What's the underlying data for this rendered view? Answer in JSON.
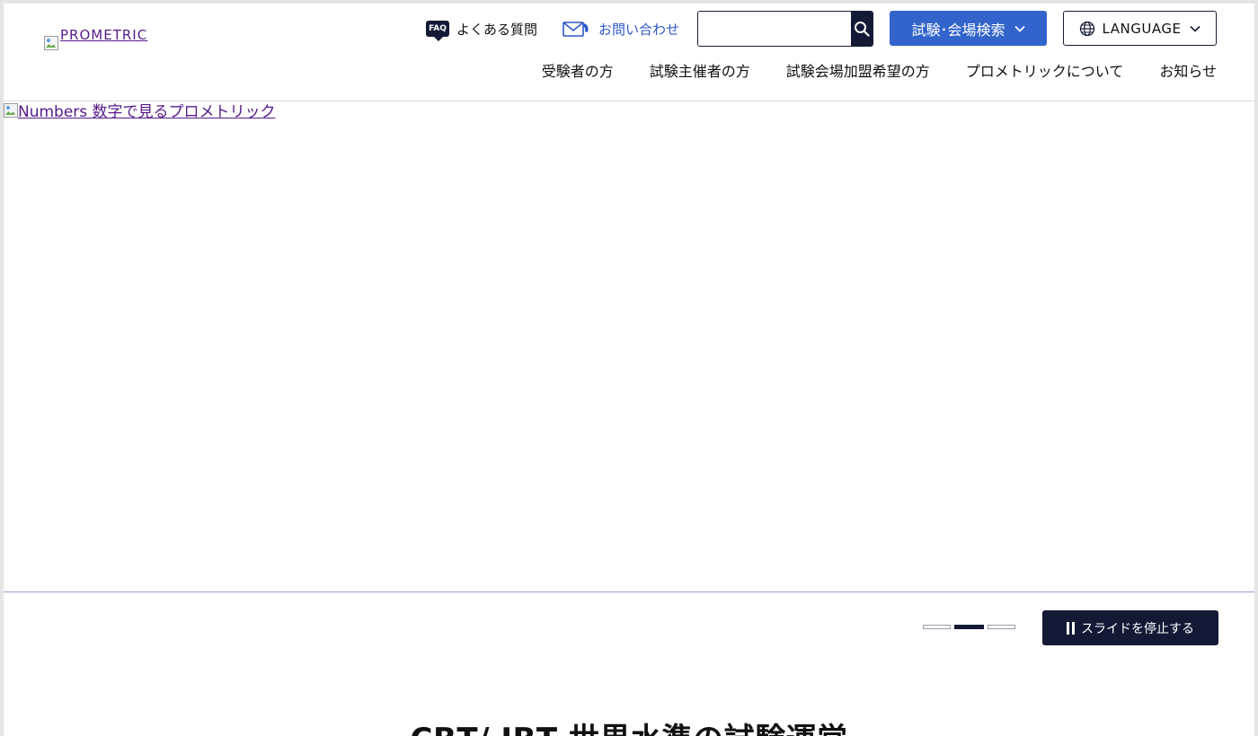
{
  "header": {
    "logo_alt": "PROMETRIC",
    "faq": {
      "badge": "FAQ",
      "label": "よくある質問"
    },
    "contact": {
      "label": "お問い合わせ"
    },
    "search": {
      "placeholder": ""
    },
    "exam_search_label": "試験･会場検索",
    "language_label": "LANGUAGE",
    "nav": [
      {
        "label": "受験者の方"
      },
      {
        "label": "試験主催者の方"
      },
      {
        "label": "試験会場加盟希望の方"
      },
      {
        "label": "プロメトリックについて"
      },
      {
        "label": "お知らせ"
      }
    ]
  },
  "hero": {
    "image_alt": "Numbers 数字で見るプロメトリック"
  },
  "slider": {
    "dots": 3,
    "active_dot": 2,
    "pause_label": "スライドを停止する"
  },
  "section": {
    "title": "CBT/ IBT 世界水準の試験運営"
  },
  "colors": {
    "navy": "#141a36",
    "accent_blue": "#3264cc",
    "link_blue": "#2d57c8",
    "visited_link": "#551a8b"
  }
}
